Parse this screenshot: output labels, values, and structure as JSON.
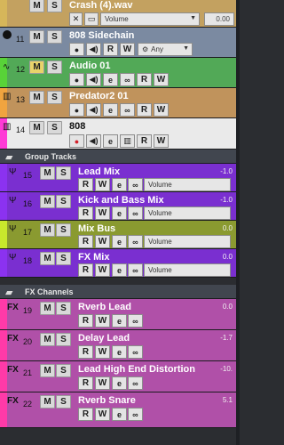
{
  "tracks_top": [
    {
      "id": "crash",
      "name": "Crash (4).wav",
      "color": "#d6b65a",
      "bg": "#c3a160",
      "number": "",
      "volume_label": "Volume",
      "volume_value": "0.00"
    },
    {
      "id": "sidechain",
      "name": "808 Sidechain",
      "color": "#1c1c1c",
      "bg": "#7b8aa1",
      "number": "11",
      "any_label": "Any"
    },
    {
      "id": "audio01",
      "name": "Audio 01",
      "color": "#58d338",
      "bg": "#52a957",
      "number": "12"
    },
    {
      "id": "predator",
      "name": "Predator2 01",
      "color": "#f0a43f",
      "bg": "#c0935c",
      "number": "13"
    },
    {
      "id": "t808",
      "name": "808",
      "color": "#ff3ad6",
      "bg": "#eaeaea",
      "number": "14"
    }
  ],
  "section_group": "Group Tracks",
  "group_tracks": [
    {
      "name": "Lead Mix",
      "number": "15",
      "value": "-1.0"
    },
    {
      "name": "Kick and Bass Mix",
      "number": "16",
      "value": "-1.0"
    },
    {
      "name": "Mix Bus",
      "number": "17",
      "value": "0.0"
    },
    {
      "name": "FX Mix",
      "number": "18",
      "value": "0.0"
    }
  ],
  "section_fx": "FX Channels",
  "fx_tracks": [
    {
      "name": "Rverb Lead",
      "number": "19",
      "value": "0.0"
    },
    {
      "name": "Delay Lead",
      "number": "20",
      "value": "-1.7"
    },
    {
      "name": "Lead High End Distortion",
      "number": "21",
      "value": "-10."
    },
    {
      "name": "Rverb Snare",
      "number": "22",
      "value": "5.1"
    }
  ],
  "labels": {
    "m": "M",
    "s": "S",
    "r": "R",
    "w": "W",
    "volume": "Volume",
    "fx_tag": "FX"
  }
}
